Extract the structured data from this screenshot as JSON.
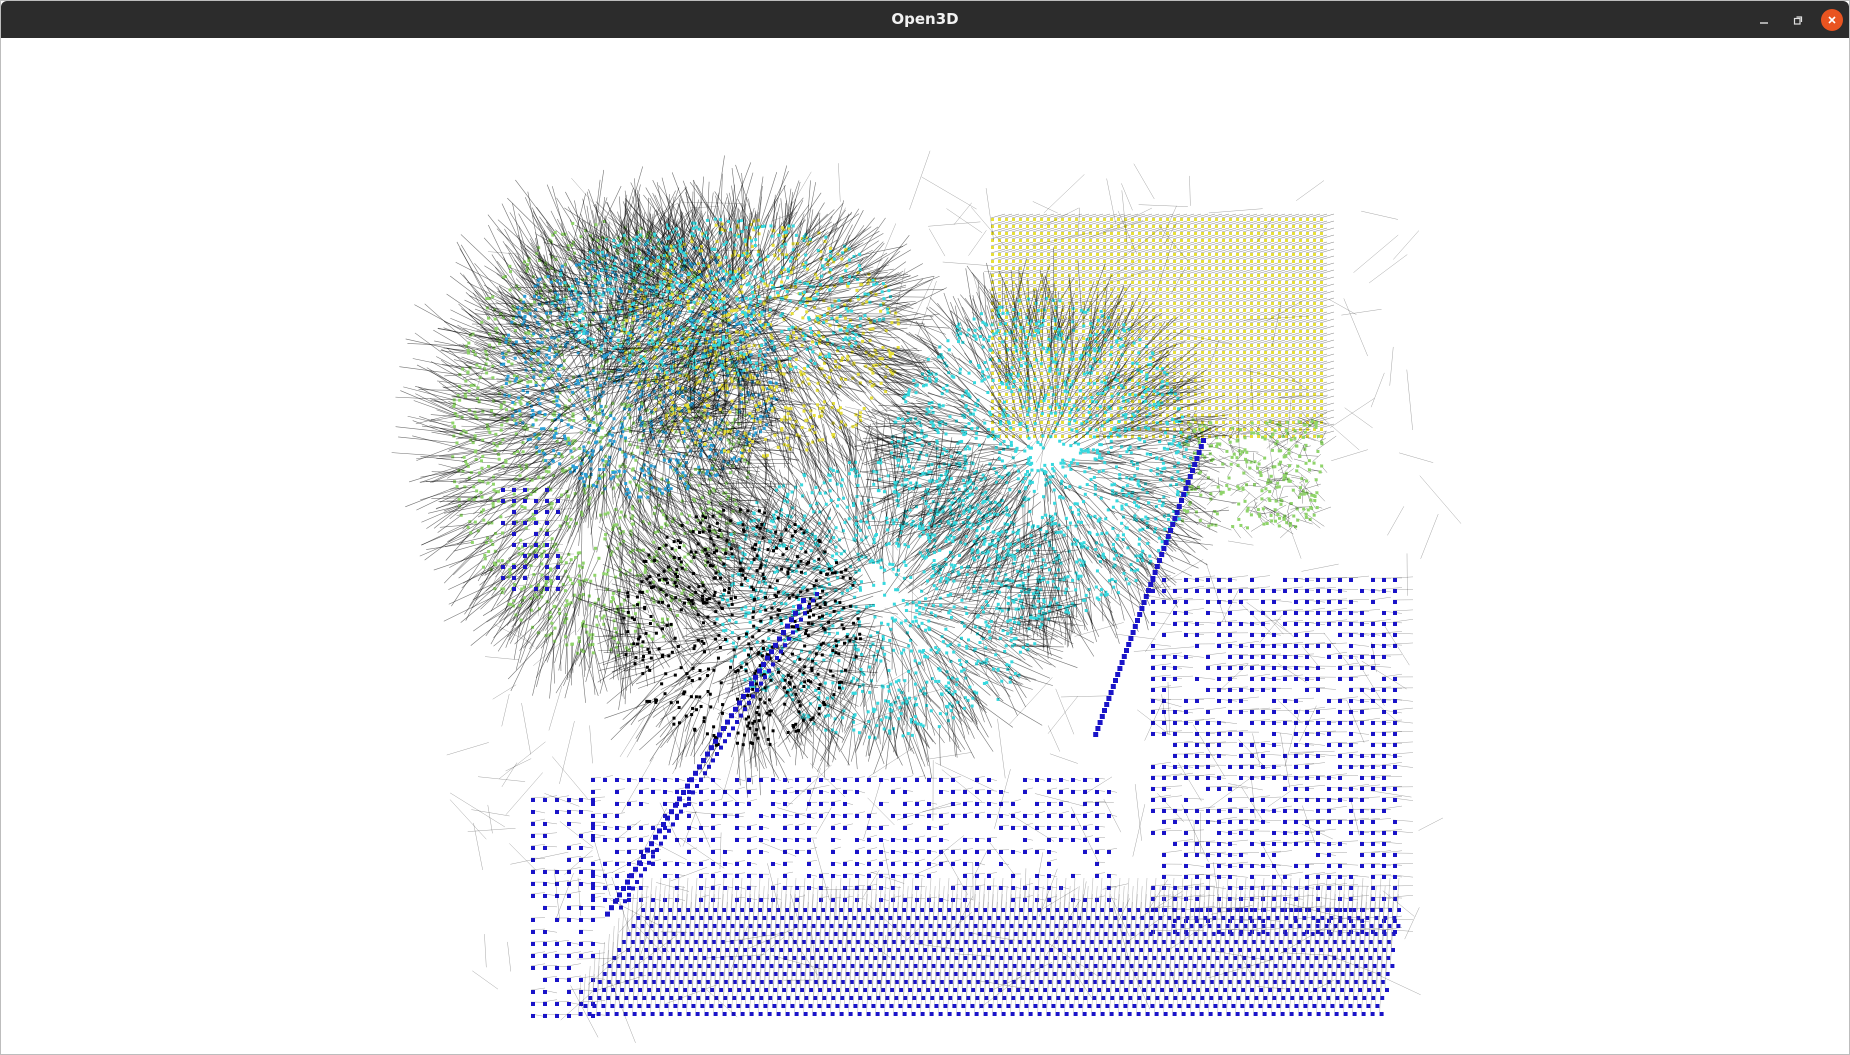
{
  "window": {
    "title": "Open3D"
  },
  "controls": {
    "minimize_icon": "minimize-icon",
    "maximize_icon": "restore-icon",
    "close_icon": "close-icon",
    "close_color": "#e95420"
  },
  "scene": {
    "description_kind": "point-cloud-with-normals",
    "background": "#ffffff",
    "colors": {
      "normals": "#000000",
      "yellow_wall": "#e6df3a",
      "cyan_sculpture": "#36d8de",
      "light_blue": "#2a9fd6",
      "green_plants": "#8fd46a",
      "dark_blue_points": "#1a14c8",
      "floor_gray": "#8a8a8a"
    }
  }
}
